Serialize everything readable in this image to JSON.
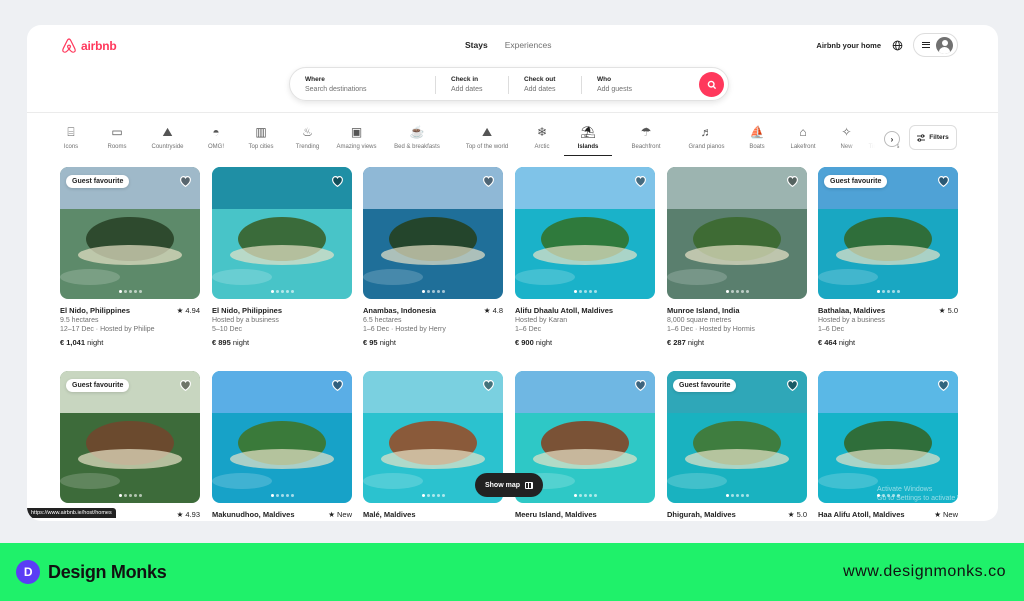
{
  "header": {
    "brand": "airbnb",
    "nav": [
      {
        "label": "Stays",
        "active": true
      },
      {
        "label": "Experiences",
        "active": false
      }
    ],
    "host_link": "Airbnb your home",
    "icons": [
      "airbnb-logo-icon",
      "globe-icon",
      "menu-icon",
      "user-avatar-icon"
    ]
  },
  "search": {
    "where": {
      "label": "Where",
      "placeholder": "Search destinations"
    },
    "checkin": {
      "label": "Check in",
      "value": "Add dates"
    },
    "checkout": {
      "label": "Check out",
      "value": "Add dates"
    },
    "who": {
      "label": "Who",
      "value": "Add guests"
    }
  },
  "categories": [
    {
      "label": "Icons",
      "icon": "icons-icon",
      "glyph": "⌸"
    },
    {
      "label": "Rooms",
      "icon": "bed-icon",
      "glyph": "▭"
    },
    {
      "label": "Countryside",
      "icon": "countryside-icon",
      "glyph": "⛰"
    },
    {
      "label": "OMG!",
      "icon": "ufo-icon",
      "glyph": "◓"
    },
    {
      "label": "Top cities",
      "icon": "city-icon",
      "glyph": "▥"
    },
    {
      "label": "Trending",
      "icon": "flame-icon",
      "glyph": "♨"
    },
    {
      "label": "Amazing views",
      "icon": "views-icon",
      "glyph": "▣"
    },
    {
      "label": "Bed & breakfasts",
      "icon": "coffee-icon",
      "glyph": "☕"
    },
    {
      "label": "Top of the world",
      "icon": "summit-icon",
      "glyph": "⛰"
    },
    {
      "label": "Arctic",
      "icon": "snowflake-icon",
      "glyph": "❄"
    },
    {
      "label": "Islands",
      "icon": "island-icon",
      "glyph": "⛱",
      "selected": true
    },
    {
      "label": "Beachfront",
      "icon": "beach-icon",
      "glyph": "☂"
    },
    {
      "label": "Grand pianos",
      "icon": "piano-icon",
      "glyph": "♬"
    },
    {
      "label": "Boats",
      "icon": "boat-icon",
      "glyph": "⛵"
    },
    {
      "label": "Lakefront",
      "icon": "lake-icon",
      "glyph": "⌂"
    },
    {
      "label": "New",
      "icon": "sparkle-icon",
      "glyph": "✧"
    },
    {
      "label": "Tiny homes",
      "icon": "tiny-home-icon",
      "glyph": "⌂"
    }
  ],
  "filters_label": "Filters",
  "listings": [
    {
      "title": "El Nido, Philippines",
      "rating": "★ 4.94",
      "line1": "9.5 hectares",
      "line2": "12–17 Dec · Hosted by Philipe",
      "price": "€ 1,041",
      "unit": "night",
      "badge": "Guest favourite",
      "scene": [
        "#9fb9c9",
        "#2e4a2e",
        "#5d8a6a"
      ]
    },
    {
      "title": "El Nido, Philippines",
      "rating": "",
      "line1": "Hosted by a business",
      "line2": "5–10 Dec",
      "price": "€ 895",
      "unit": "night",
      "badge": "",
      "scene": [
        "#1f8fa5",
        "#3a6b3a",
        "#48c4c8"
      ]
    },
    {
      "title": "Anambas, Indonesia",
      "rating": "★ 4.8",
      "line1": "6.5 hectares",
      "line2": "1–6 Dec · Hosted by Herry",
      "price": "€ 95",
      "unit": "night",
      "badge": "",
      "scene": [
        "#8fb8d6",
        "#24452c",
        "#1f6f99"
      ]
    },
    {
      "title": "Alifu Dhaalu Atoll, Maldives",
      "rating": "",
      "line1": "Hosted by Karan",
      "line2": "1–6 Dec",
      "price": "€ 900",
      "unit": "night",
      "badge": "",
      "scene": [
        "#7fc3e8",
        "#2f7a3c",
        "#1ab2c9"
      ]
    },
    {
      "title": "Munroe Island, India",
      "rating": "",
      "line1": "8,000 square metres",
      "line2": "1–6 Dec · Hosted by Hormis",
      "price": "€ 287",
      "unit": "night",
      "badge": "",
      "scene": [
        "#9cb4b0",
        "#3e6b34",
        "#5a7f6e"
      ]
    },
    {
      "title": "Bathalaa, Maldives",
      "rating": "★ 5.0",
      "line1": "Hosted by a business",
      "line2": "1–6 Dec",
      "price": "€ 464",
      "unit": "night",
      "badge": "Guest favourite",
      "scene": [
        "#4fa2d6",
        "#2f6e3a",
        "#19a7c2"
      ]
    },
    {
      "title": "Thailand",
      "rating": "★ 4.93",
      "line1": "",
      "line2": "",
      "price": "",
      "unit": "",
      "badge": "Guest favourite",
      "scene": [
        "#c8d6c0",
        "#6b4a2e",
        "#3d6b3a"
      ]
    },
    {
      "title": "Makunudhoo, Maldives",
      "rating": "★ New",
      "line1": "",
      "line2": "",
      "price": "",
      "unit": "",
      "badge": "",
      "scene": [
        "#5aaee6",
        "#3a7a3a",
        "#17a2c8"
      ]
    },
    {
      "title": "Malé, Maldives",
      "rating": "",
      "line1": "",
      "line2": "",
      "price": "",
      "unit": "",
      "badge": "",
      "scene": [
        "#7ad0e0",
        "#8a5a3a",
        "#2bc2cf"
      ]
    },
    {
      "title": "Meeru Island, Maldives",
      "rating": "",
      "line1": "",
      "line2": "",
      "price": "",
      "unit": "",
      "badge": "",
      "scene": [
        "#6fb7e3",
        "#7a5236",
        "#2ec8c6"
      ]
    },
    {
      "title": "Dhigurah, Maldives",
      "rating": "★ 5.0",
      "line1": "",
      "line2": "",
      "price": "",
      "unit": "",
      "badge": "Guest favourite",
      "scene": [
        "#2fa7b8",
        "#3f7d3f",
        "#19b2c0"
      ]
    },
    {
      "title": "Haa Alifu Atoll, Maldives",
      "rating": "★ New",
      "line1": "",
      "line2": "",
      "price": "",
      "unit": "",
      "badge": "",
      "scene": [
        "#5ab8e6",
        "#2f6e3a",
        "#16b3c9"
      ]
    }
  ],
  "map_button": "Show map",
  "url_tooltip": "https://www.airbnb.ie/host/homes",
  "watermark": [
    "Activate Windows",
    "Go to Settings to activate Windows."
  ],
  "footer": {
    "brand": "Design Monks",
    "url": "www.designmonks.co",
    "accent": "#1ff16a"
  }
}
